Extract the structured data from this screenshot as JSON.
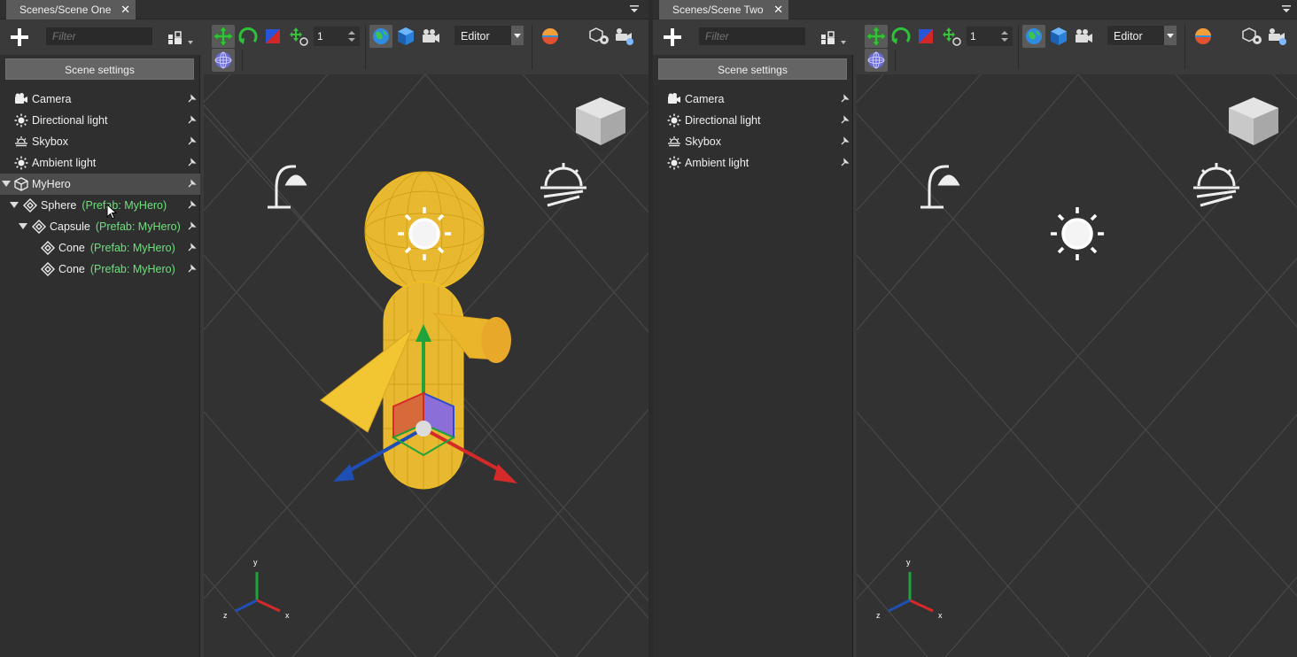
{
  "left": {
    "tab": {
      "title": "Scenes/Scene One",
      "close": "✕"
    },
    "filter_placeholder": "Filter",
    "scene_settings": "Scene settings",
    "count_value": "1",
    "mode_select": "Editor",
    "tree": [
      {
        "label": "Camera",
        "icon": "camera-icon"
      },
      {
        "label": "Directional light",
        "icon": "directional-light-icon"
      },
      {
        "label": "Skybox",
        "icon": "skybox-icon"
      },
      {
        "label": "Ambient light",
        "icon": "ambient-light-icon"
      },
      {
        "label": "MyHero",
        "icon": "cube-icon"
      },
      {
        "label": "Sphere",
        "prefab": "(Prefab: MyHero)",
        "icon": "prefab-icon"
      },
      {
        "label": "Capsule",
        "prefab": "(Prefab: MyHero)",
        "icon": "prefab-icon"
      },
      {
        "label": "Cone",
        "prefab": "(Prefab: MyHero)",
        "icon": "prefab-icon"
      },
      {
        "label": "Cone",
        "prefab": "(Prefab: MyHero)",
        "icon": "prefab-icon"
      }
    ],
    "axes": {
      "x": "x",
      "y": "y",
      "z": "z"
    }
  },
  "right": {
    "tab": {
      "title": "Scenes/Scene Two",
      "close": "✕"
    },
    "filter_placeholder": "Filter",
    "scene_settings": "Scene settings",
    "count_value": "1",
    "mode_select": "Editor",
    "tree": [
      {
        "label": "Camera",
        "icon": "camera-icon"
      },
      {
        "label": "Directional light",
        "icon": "directional-light-icon"
      },
      {
        "label": "Skybox",
        "icon": "skybox-icon"
      },
      {
        "label": "Ambient light",
        "icon": "ambient-light-icon"
      }
    ],
    "axes": {
      "x": "x",
      "y": "y",
      "z": "z"
    }
  },
  "colors": {
    "prefab_text": "#6fe07d",
    "selection_wire": "#f5c21b",
    "gizmo_x": "#d42a2a",
    "gizmo_y": "#1fa33a",
    "gizmo_z": "#1e4fb5"
  }
}
